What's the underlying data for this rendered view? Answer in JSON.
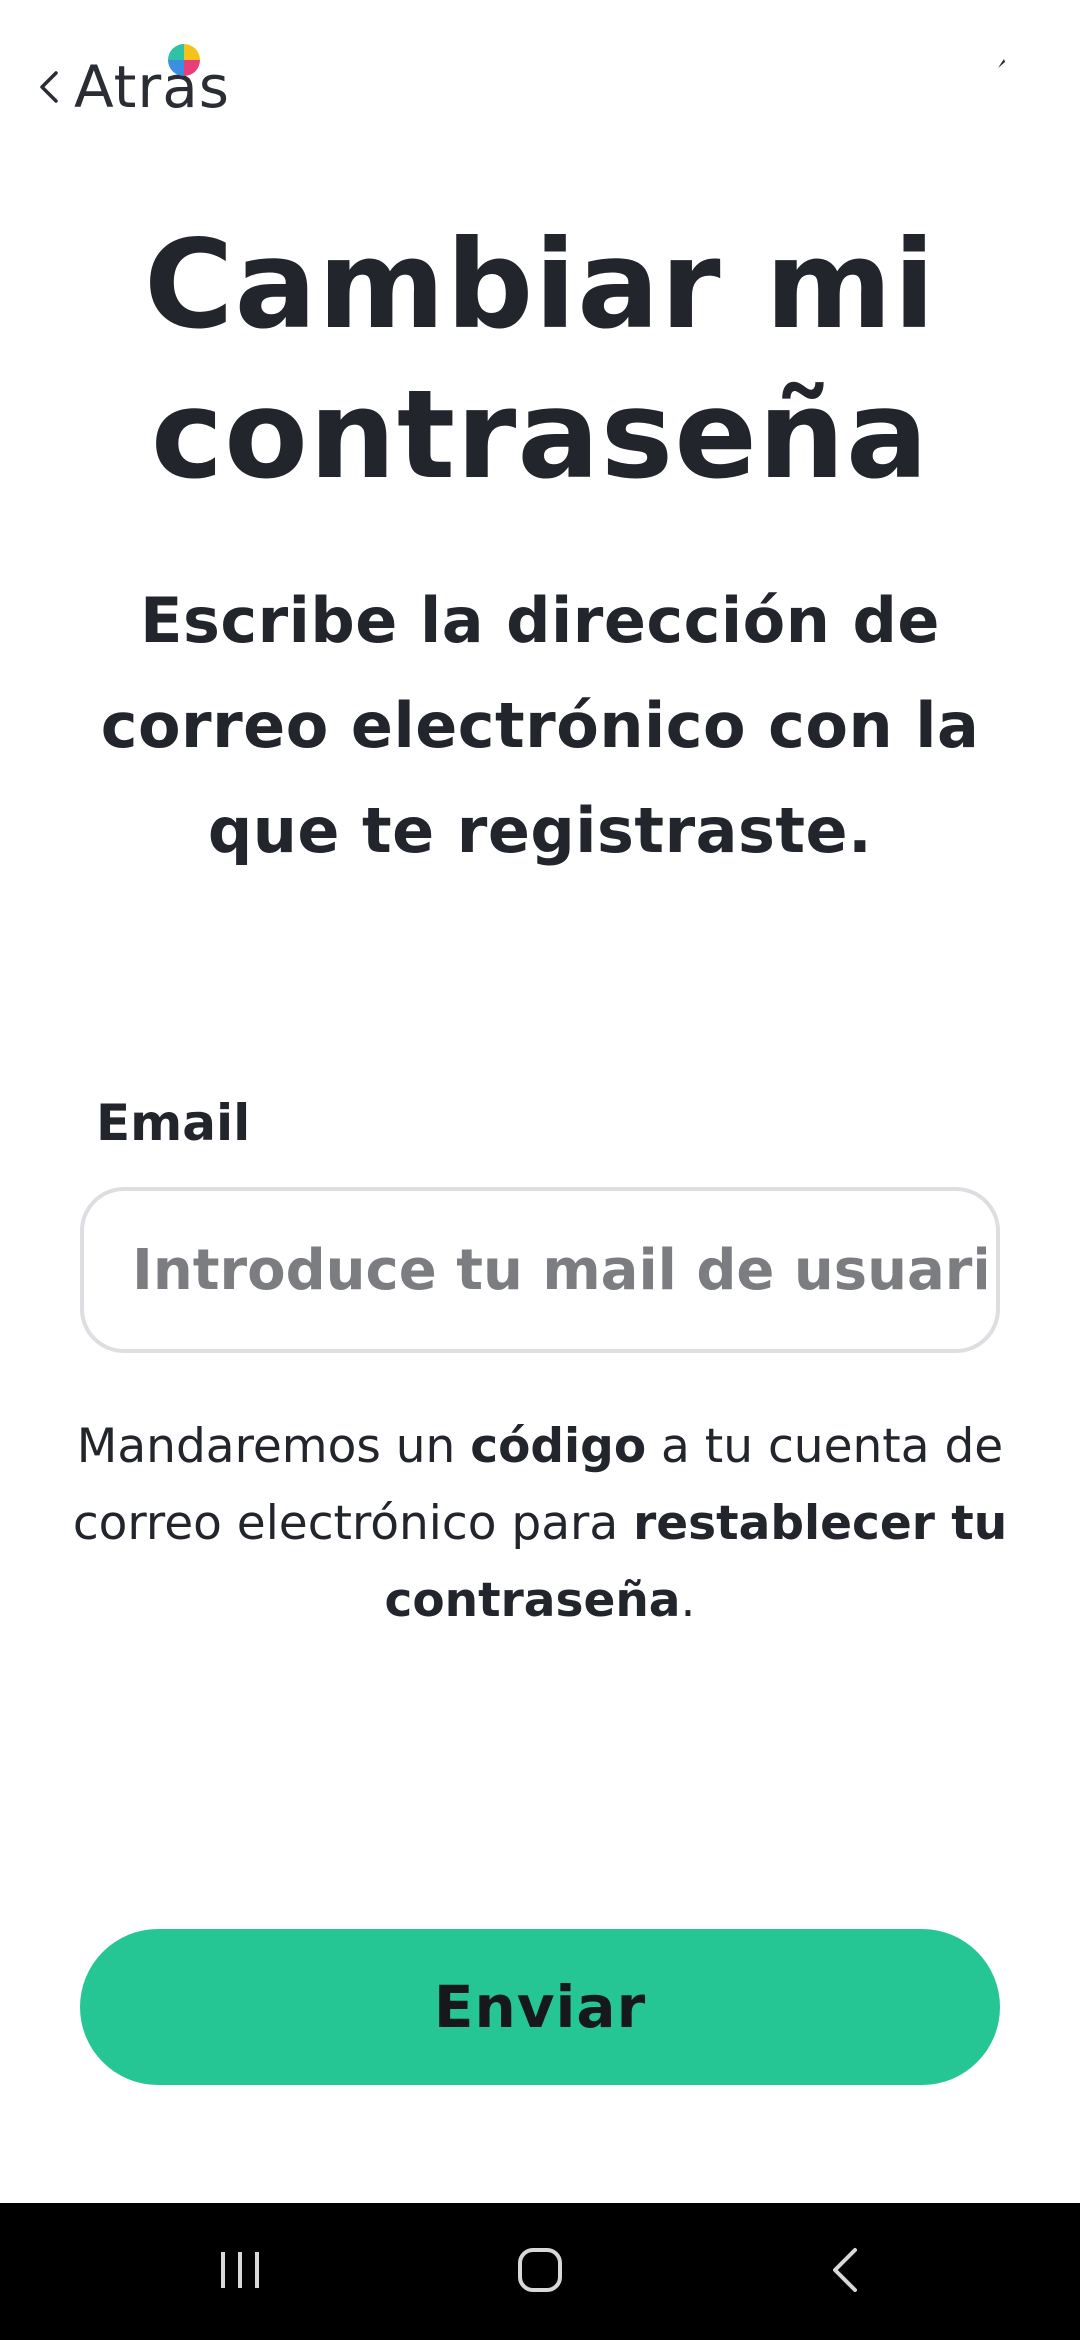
{
  "header": {
    "back_label": "Atrás"
  },
  "title": {
    "line1": "Cambiar mi",
    "line2": "contraseña"
  },
  "subtitle": {
    "line1": "Escribe la dirección de",
    "line2": "correo electrónico con la",
    "line3": "que te registraste."
  },
  "form": {
    "email_label": "Email",
    "email_value": "",
    "email_placeholder": "Introduce tu mail de usuario"
  },
  "info": {
    "part1": "Mandaremos un ",
    "bold1": "código",
    "part2": " a tu cuenta de correo electrónico para ",
    "bold2": "restablecer tu contraseña",
    "part3": "."
  },
  "actions": {
    "submit_label": "Enviar"
  },
  "colors": {
    "accent": "#25c693",
    "text": "#22252b",
    "input_border": "#dedee2",
    "placeholder": "#7c7d80",
    "nav_bar": "#000000"
  },
  "icons": {
    "back": "chevron-left-icon",
    "logo": "color-wheel-logo",
    "recents": "recent-apps-icon",
    "home": "home-icon",
    "nav_back": "back-icon"
  }
}
